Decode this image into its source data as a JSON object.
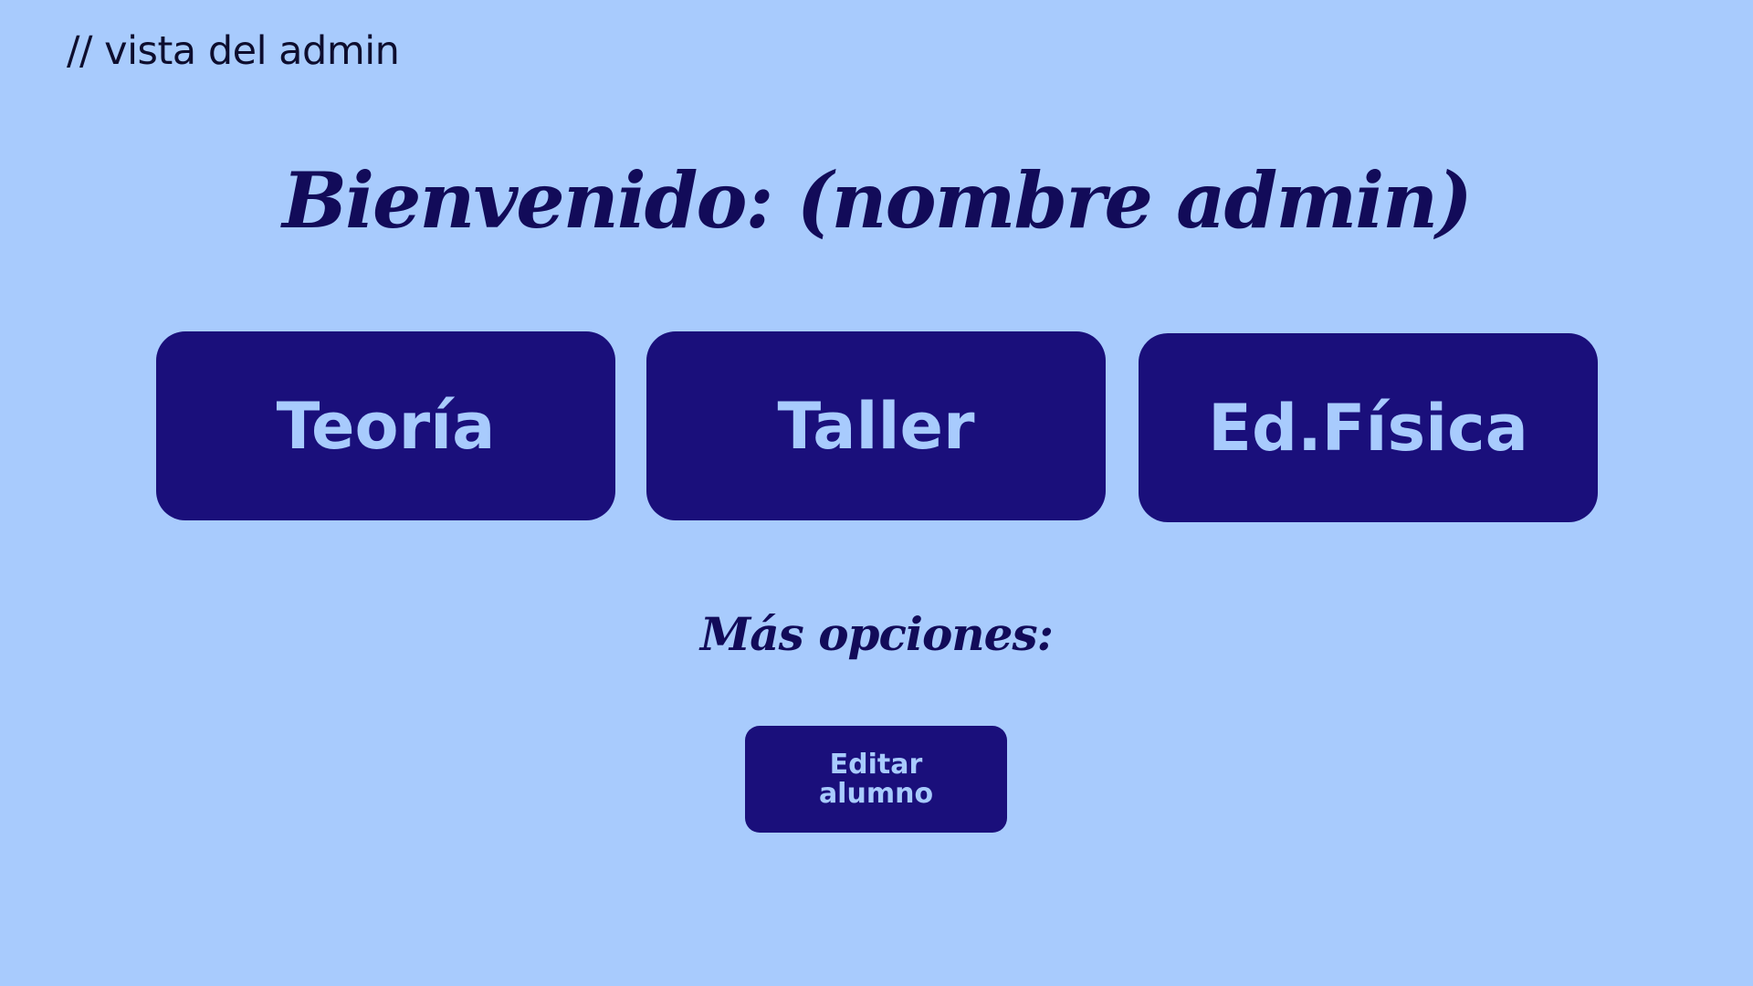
{
  "note": "// vista del admin",
  "welcome_title": "Bienvenido: (nombre admin)",
  "sections": [
    {
      "label": "Teoría"
    },
    {
      "label": "Taller"
    },
    {
      "label": "Ed.Física"
    }
  ],
  "more_options": {
    "heading": "Más opciones:",
    "edit_student": {
      "line1": "Editar",
      "line2": "alumno"
    }
  },
  "colors": {
    "background": "#a8cbfd",
    "button": "#1a0f7b",
    "button_text": "#a8cbfd",
    "heading": "#120b59"
  }
}
